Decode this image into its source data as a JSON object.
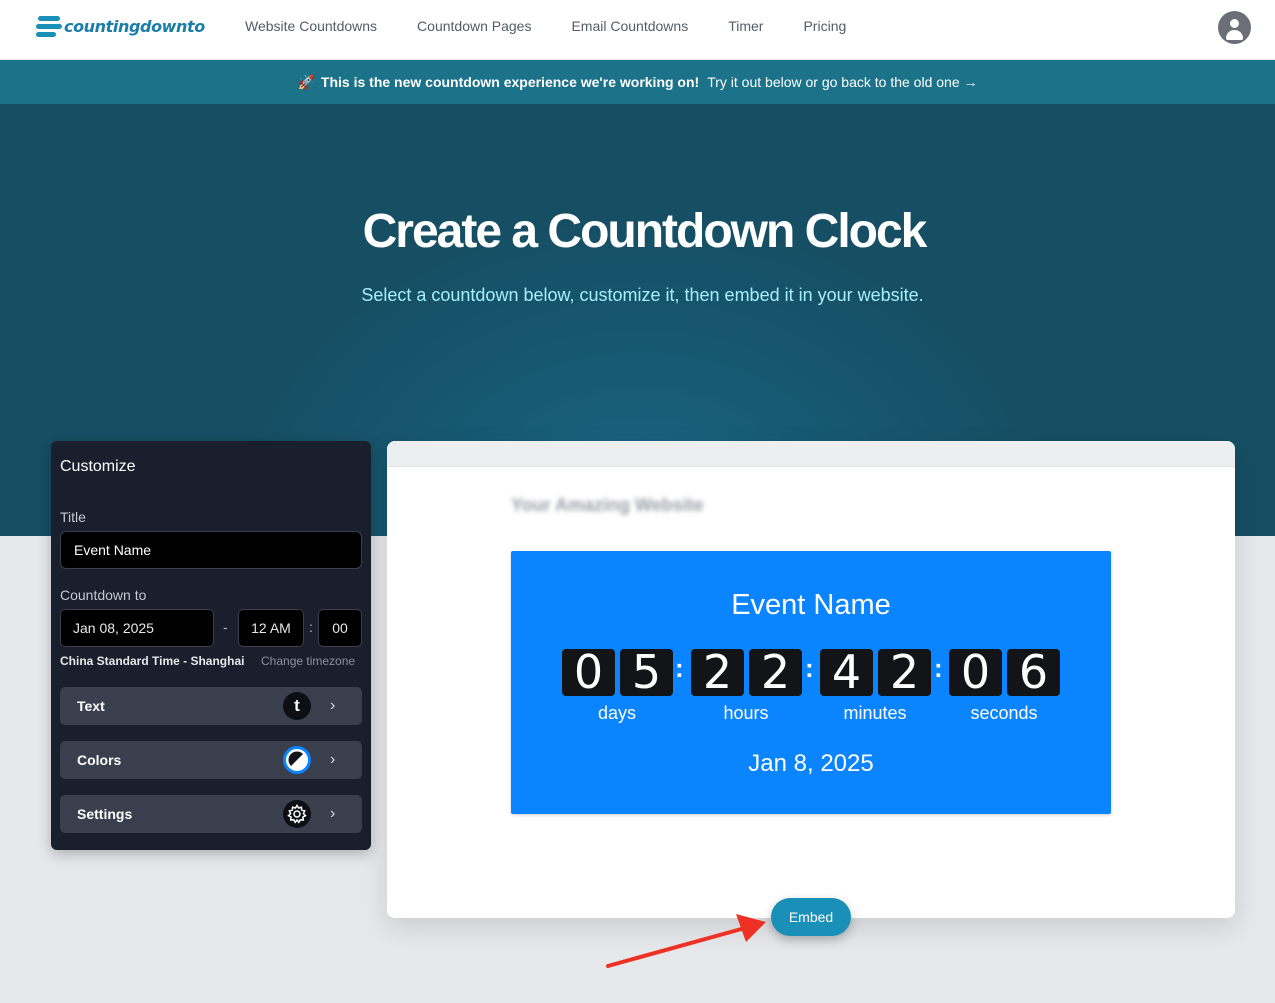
{
  "nav": {
    "logo_text": "countingdownto",
    "links": [
      "Website Countdowns",
      "Countdown Pages",
      "Email Countdowns",
      "Timer",
      "Pricing"
    ],
    "avatar_icon": "user-avatar-icon"
  },
  "banner": {
    "icon": "🚀",
    "bold_text": "This is the new countdown experience we're working on!",
    "text": "Try it out below or go back to the old one →"
  },
  "hero": {
    "title": "Create a Countdown Clock",
    "subtitle": "Select a countdown below, customize it, then embed it in your website."
  },
  "customize": {
    "heading": "Customize",
    "title_label": "Title",
    "title_value": "Event Name",
    "countdown_label": "Countdown to",
    "date": "Jan 08, 2025",
    "dash": "-",
    "hour": "12 AM",
    "colon": ":",
    "minute": "00",
    "timezone": "China Standard Time - Shanghai",
    "change_timezone": "Change timezone",
    "sections": [
      {
        "label": "Text",
        "icon": "t"
      },
      {
        "label": "Colors",
        "icon": ""
      },
      {
        "label": "Settings",
        "icon": ""
      }
    ],
    "chevron": "›"
  },
  "preview": {
    "fake_site_title": "Your Amazing Website",
    "event_title": "Event Name",
    "digits": [
      "0",
      "5",
      "2",
      "2",
      "4",
      "2",
      "0",
      "6"
    ],
    "colon": ":",
    "units": [
      "days",
      "hours",
      "minutes",
      "seconds"
    ],
    "date": "Jan 8, 2025",
    "accent_color": "#0a84ff"
  },
  "embed_label": "Embed"
}
